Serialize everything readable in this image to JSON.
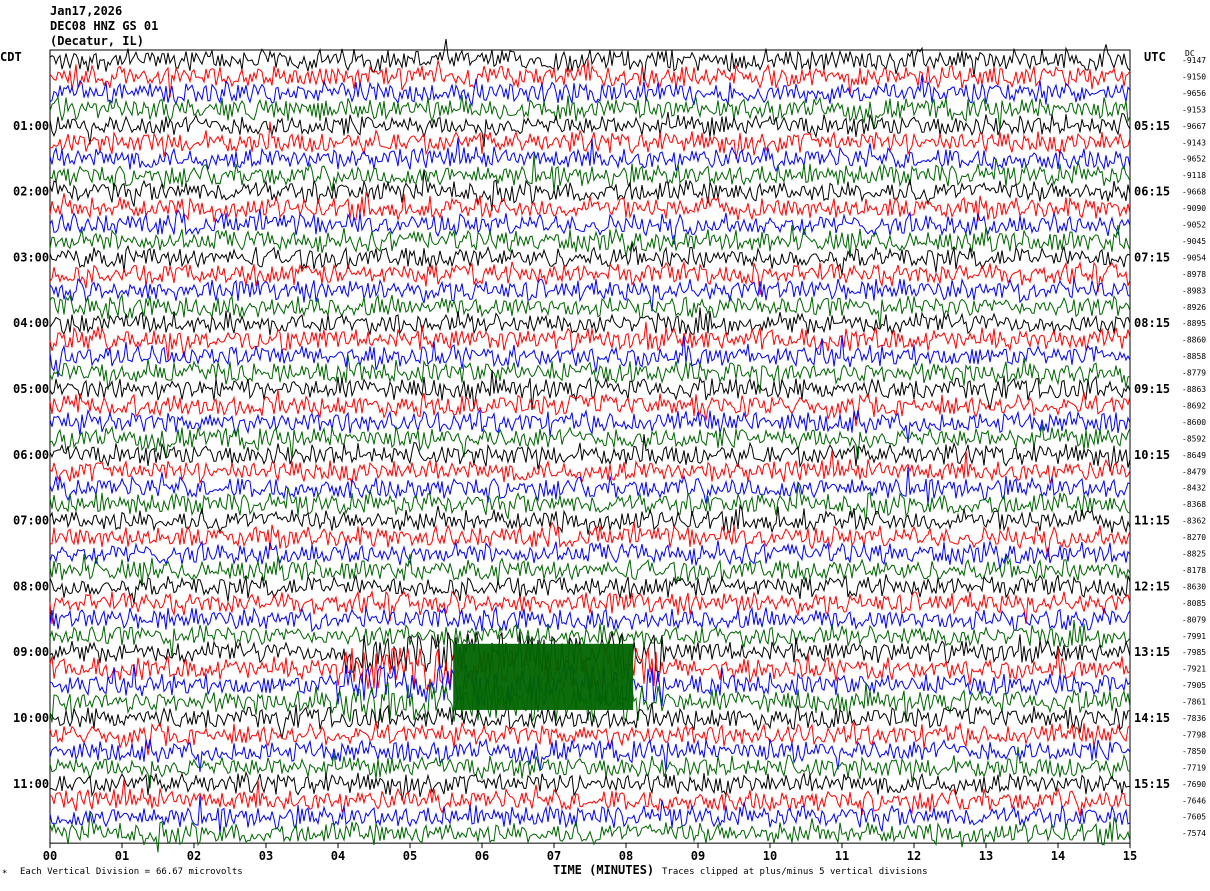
{
  "header": {
    "date": "Jan17,2026",
    "station": "DEC08 HNZ GS 01",
    "location": "(Decatur, IL)"
  },
  "left_timezone": "CDT",
  "right_timezone": "UTC",
  "right_corner_label": "DC",
  "footer": {
    "marker": "*",
    "division_label": "Each Vertical Division =",
    "division_value": "66.67 microvolts",
    "clip_note": "Traces clipped at plus/minus 5 vertical divisions"
  },
  "chart_data": {
    "type": "line",
    "title": "",
    "xlabel": "TIME (MINUTES)",
    "ylabel": "",
    "xlim": [
      0,
      15
    ],
    "x_ticks": [
      "00",
      "01",
      "02",
      "03",
      "04",
      "05",
      "06",
      "07",
      "08",
      "09",
      "10",
      "11",
      "12",
      "13",
      "14",
      "15"
    ],
    "rows_per_hour": 4,
    "minutes_per_row": 15,
    "row_count": 48,
    "trace_colors": [
      "#000000",
      "#ff0000",
      "#0000ff",
      "#006400"
    ],
    "left_hour_labels": [
      "01:00",
      "02:00",
      "03:00",
      "04:00",
      "05:00",
      "06:00",
      "07:00",
      "08:00",
      "09:00",
      "10:00",
      "11:00"
    ],
    "left_hour_label_rows": [
      4,
      8,
      12,
      16,
      20,
      24,
      28,
      32,
      36,
      40,
      44
    ],
    "right_hour_labels": [
      "05:15",
      "06:15",
      "07:15",
      "08:15",
      "09:15",
      "10:15",
      "11:15",
      "12:15",
      "13:15",
      "14:15",
      "15:15"
    ],
    "right_hour_label_rows": [
      4,
      8,
      12,
      16,
      20,
      24,
      28,
      32,
      36,
      40,
      44
    ],
    "right_row_offsets": [
      "-9147",
      "-9150",
      "-9656",
      "-9153",
      "-9667",
      "-9143",
      "-9652",
      "-9118",
      "-9668",
      "-9090",
      "-9052",
      "-9045",
      "-9054",
      "-8978",
      "-8983",
      "-8926",
      "-8895",
      "-8860",
      "-8858",
      "-8779",
      "-8863",
      "-8692",
      "-8600",
      "-8592",
      "-8649",
      "-8479",
      "-8432",
      "-8368",
      "-8362",
      "-8270",
      "-8825",
      "-8178",
      "-8630",
      "-8085",
      "-8079",
      "-7991",
      "-7985",
      "-7921",
      "-7905",
      "-7861",
      "-7836",
      "-7798",
      "-7850",
      "-7719",
      "-7690",
      "-7646",
      "-7605",
      "-7574"
    ],
    "amplitude_unit": "vertical divisions",
    "clip_level_divisions": 5,
    "microvolts_per_division": 66.67,
    "events": [
      {
        "description": "large sustained signal",
        "row_start": 36,
        "row_end": 39,
        "minute_start": 4.0,
        "minute_end": 8.5,
        "color": "#006400"
      }
    ]
  }
}
